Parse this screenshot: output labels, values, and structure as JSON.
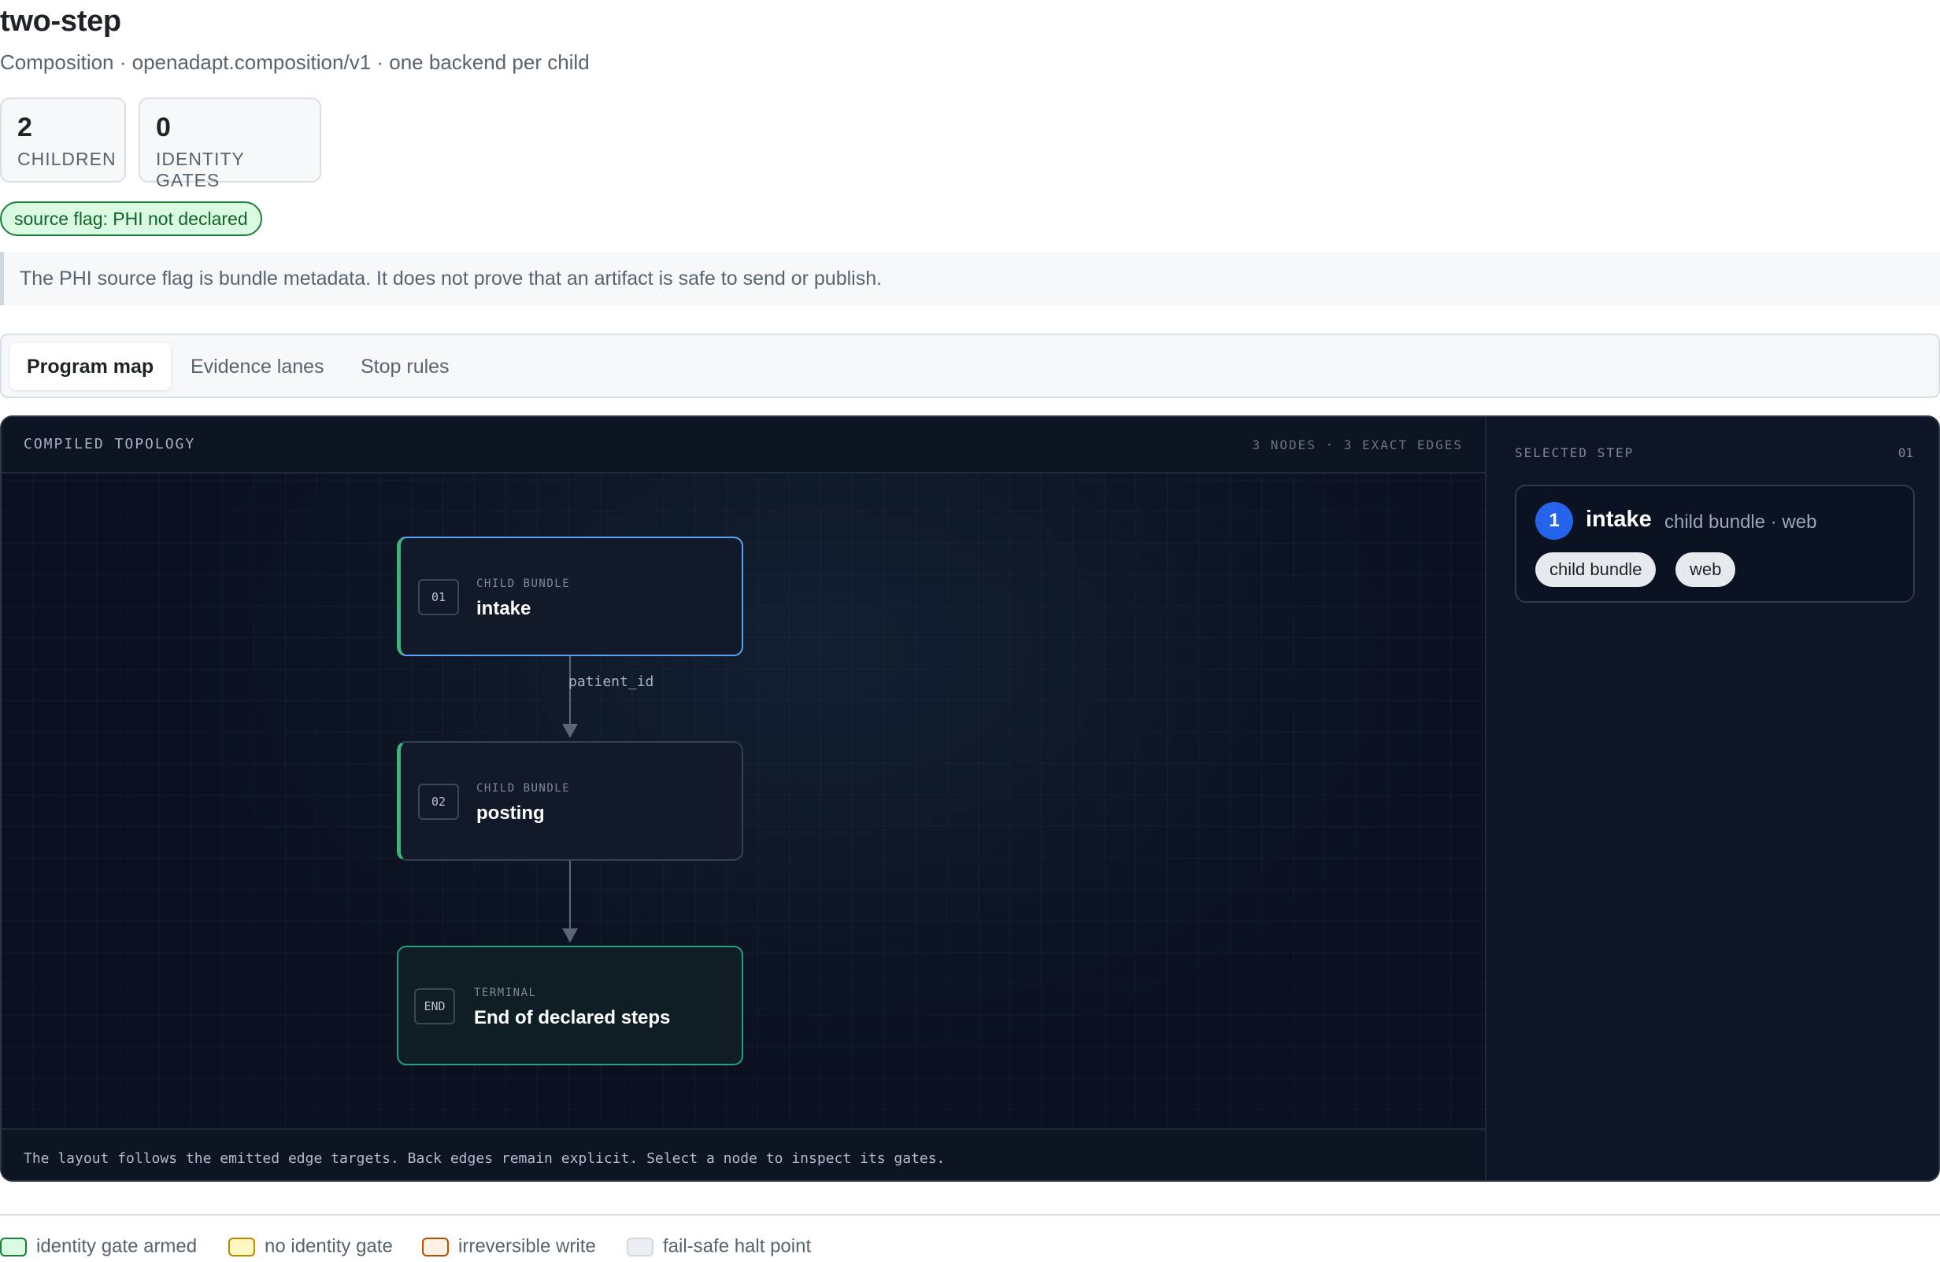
{
  "header": {
    "title": "two-step",
    "subtitle": "Composition · openadapt.composition/v1 · one backend per child"
  },
  "stats": [
    {
      "value": "2",
      "label": "CHILDREN"
    },
    {
      "value": "0",
      "label": "IDENTITY GATES"
    }
  ],
  "flag": {
    "label": "source flag: PHI not declared",
    "color": "#1a7f37"
  },
  "note": "The PHI source flag is bundle metadata. It does not prove that an artifact is safe to send or publish.",
  "tabs": [
    {
      "label": "Program map",
      "active": true
    },
    {
      "label": "Evidence lanes",
      "active": false
    },
    {
      "label": "Stop rules",
      "active": false
    }
  ],
  "topology": {
    "title": "COMPILED TOPOLOGY",
    "meta": "3 NODES · 3 EXACT EDGES",
    "nodes": [
      {
        "num": "01",
        "kind": "CHILD BUNDLE",
        "name": "intake"
      },
      {
        "num": "02",
        "kind": "CHILD BUNDLE",
        "name": "posting"
      },
      {
        "num": "END",
        "kind": "TERMINAL",
        "name": "End of declared steps"
      }
    ],
    "edge_label": "patient_id",
    "footer": "The layout follows the emitted edge targets. Back edges remain explicit. Select a node to inspect its gates."
  },
  "selected_step": {
    "title": "SELECTED STEP",
    "count": "01",
    "index": "1",
    "name": "intake",
    "sub": "child bundle · web",
    "pills": [
      "child bundle",
      "web"
    ]
  },
  "legend": [
    {
      "label": "identity gate armed",
      "color": "#1a7f37",
      "fill": "#dafbe1"
    },
    {
      "label": "no identity gate",
      "color": "#bf8700",
      "fill": "#fff8c5"
    },
    {
      "label": "irreversible write",
      "color": "#bc4c00",
      "fill": "#fff1e5"
    },
    {
      "label": "fail-safe halt point",
      "color": "#d0d7de",
      "fill": "#eaeef2"
    }
  ]
}
